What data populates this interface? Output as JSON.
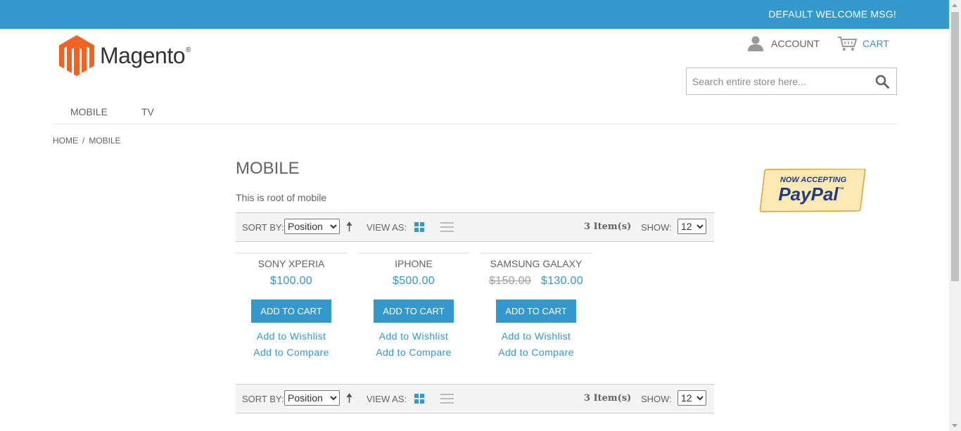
{
  "header": {
    "welcome": "DEFAULT WELCOME MSG!",
    "logo_text": "Magento",
    "logo_mark": "®",
    "account_label": "ACCOUNT",
    "cart_label": "CART",
    "search_placeholder": "Search entire store here..."
  },
  "nav": {
    "items": [
      "MOBILE",
      "TV"
    ]
  },
  "breadcrumb": {
    "home": "HOME",
    "separator": "/",
    "current": "MOBILE"
  },
  "category": {
    "title": "MOBILE",
    "description": "This is root of mobile"
  },
  "promo": {
    "line1": "NOW ACCEPTING",
    "line2": "PayPal",
    "tm": "™"
  },
  "toolbar": {
    "sort_label": "SORT BY:",
    "sort_value": "Position",
    "view_label": "VIEW AS:",
    "count": "3 Item(s)",
    "show_label": "SHOW:",
    "show_value": "12"
  },
  "products": [
    {
      "name": "SONY XPERIA",
      "old_price": "",
      "price": "$100.00",
      "button": "ADD TO CART",
      "wishlist": "Add to Wishlist",
      "compare": "Add to Compare"
    },
    {
      "name": "IPHONE",
      "old_price": "",
      "price": "$500.00",
      "button": "ADD TO CART",
      "wishlist": "Add to Wishlist",
      "compare": "Add to Compare"
    },
    {
      "name": "SAMSUNG GALAXY",
      "old_price": "$150.00",
      "price": "$130.00",
      "button": "ADD TO CART",
      "wishlist": "Add to Wishlist",
      "compare": "Add to Compare"
    }
  ],
  "colors": {
    "accent": "#3399cc",
    "text": "#636363",
    "logo_orange": "#f26322"
  },
  "icons": [
    "magento-logo-icon",
    "user-icon",
    "cart-icon",
    "search-icon",
    "sort-arrow-icon",
    "grid-view-icon",
    "list-view-icon"
  ]
}
